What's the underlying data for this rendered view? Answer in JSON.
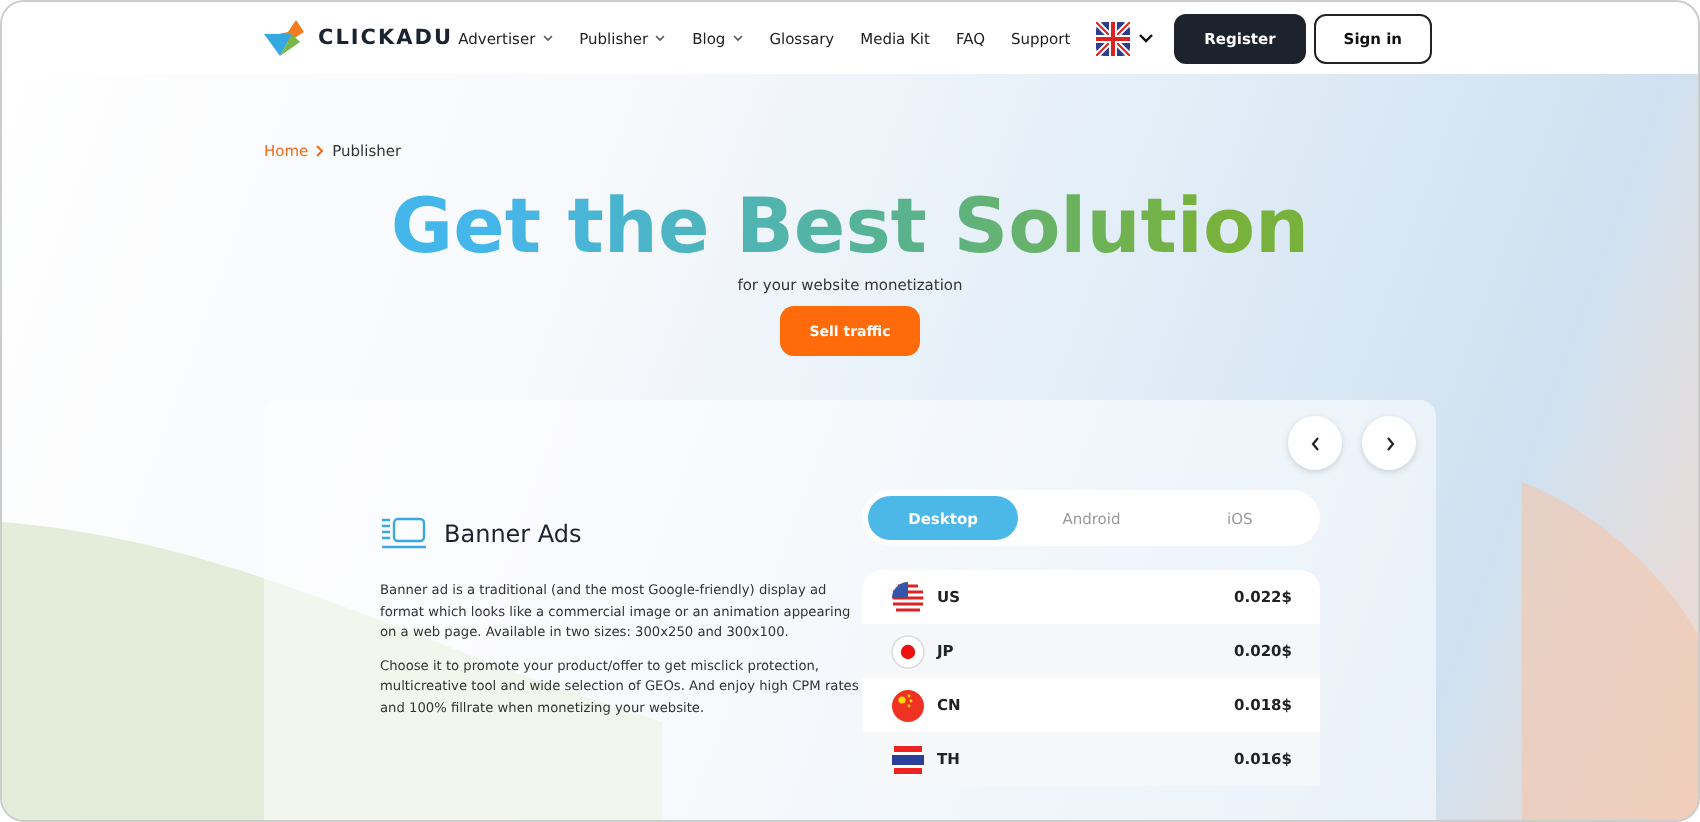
{
  "header": {
    "logo": "CLICKADU",
    "nav": [
      {
        "label": "Advertiser",
        "dropdown": true
      },
      {
        "label": "Publisher",
        "dropdown": true
      },
      {
        "label": "Blog",
        "dropdown": true
      },
      {
        "label": "Glossary",
        "dropdown": false
      },
      {
        "label": "Media Kit",
        "dropdown": false
      },
      {
        "label": "FAQ",
        "dropdown": false
      },
      {
        "label": "Support",
        "dropdown": false
      }
    ],
    "buttons": [
      {
        "label": "Register",
        "kind": "primary"
      },
      {
        "label": "Sign in",
        "kind": "outline"
      }
    ]
  },
  "breadcrumb": [
    "Home",
    "Publisher"
  ],
  "hero": {
    "title": "Get the Best Solution",
    "subtitle": "for your website monetization",
    "button": "Sell traffic"
  },
  "card": {
    "title": "Banner Ads",
    "paragraphs": [
      "Banner ad is a traditional (and the most Google-friendly) display ad format which looks like a commercial image or an animation appearing on a web page. Available in two sizes: 300x250 and 300x100.",
      "Choose it to promote your product/offer to get misclick protection, multicreative tool and wide selection of GEOs. And enjoy high CPM rates and 100% fillrate when monetizing your website."
    ],
    "tabs": [
      {
        "label": "Desktop",
        "selected": true
      },
      {
        "label": "Android",
        "selected": false
      },
      {
        "label": "iOS",
        "selected": false
      }
    ],
    "rates": [
      {
        "country": "US",
        "kind": "us",
        "rate": "0.022$"
      },
      {
        "country": "JP",
        "kind": "jp",
        "rate": "0.020$"
      },
      {
        "country": "CN",
        "kind": "cn",
        "rate": "0.018$"
      },
      {
        "country": "TH",
        "kind": "th",
        "rate": "0.016$"
      }
    ]
  }
}
